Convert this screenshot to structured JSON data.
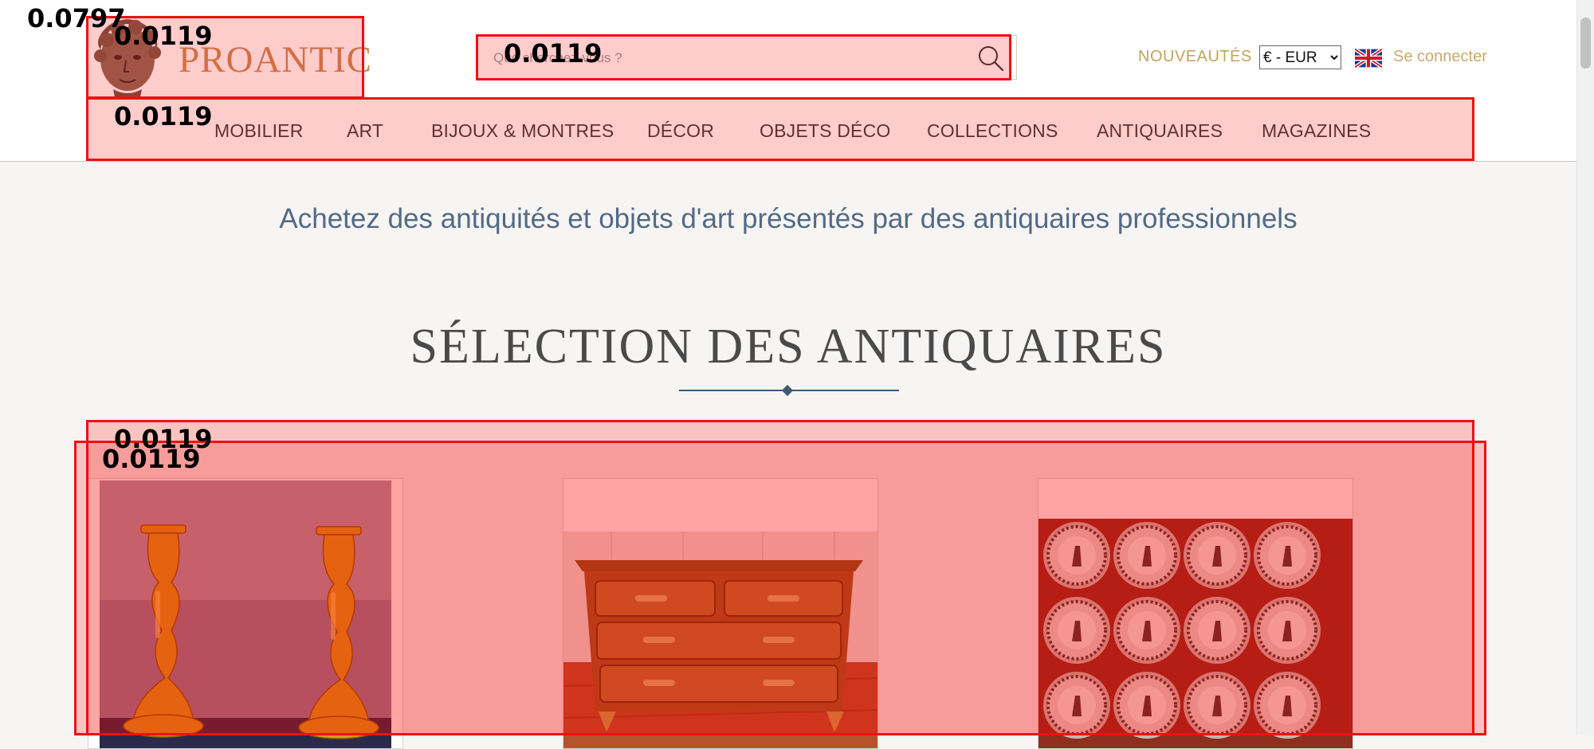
{
  "header": {
    "logo_text": "PROANTIC",
    "search_placeholder": "Que cherchez-vous ?",
    "new_label": "NOUVEAUTÉS",
    "currency": {
      "selected": "€ - EUR",
      "options": [
        "€ - EUR"
      ]
    },
    "language": "English",
    "login_label": "Se connecter"
  },
  "nav": {
    "items": [
      {
        "label": "MOBILIER"
      },
      {
        "label": "ART"
      },
      {
        "label": "BIJOUX & MONTRES"
      },
      {
        "label": "DÉCOR"
      },
      {
        "label": "OBJETS DÉCO"
      },
      {
        "label": "COLLECTIONS"
      },
      {
        "label": "ANTIQUAIRES"
      },
      {
        "label": "MAGAZINES"
      }
    ]
  },
  "main": {
    "tagline": "Achetez des antiquités et objets d'art présentés par des antiquaires professionnels",
    "section_title": "SÉLECTION DES ANTIQUAIRES",
    "cards": [
      {
        "subject": "gilt bronze candlesticks"
      },
      {
        "subject": "marquetry chest of drawers"
      },
      {
        "subject": "set of painted plates"
      }
    ]
  },
  "overlays": [
    {
      "score": "0.0797"
    },
    {
      "score": "0.0119"
    },
    {
      "score": "0.0119"
    },
    {
      "score": "0.0119"
    },
    {
      "score": "0.0119"
    },
    {
      "score": "0.0119"
    }
  ],
  "colors": {
    "accent_gold": "#c3a35d",
    "logo": "#c98a55",
    "nav_text": "#3c3c3c",
    "tagline": "#536a85",
    "overlay_border": "#ee1111"
  }
}
